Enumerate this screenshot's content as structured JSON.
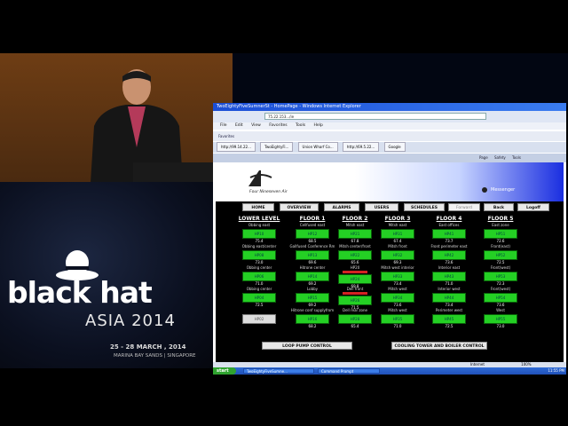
{
  "banner": {
    "title": "black hat",
    "subtitle": "ASIA 2014",
    "dates": "25 - 28 MARCH , 2014",
    "venue": "MARINA BAY SANDS  |  SINGAPORE"
  },
  "browser": {
    "window_title": "TwoEightyFiveSumnerSt - HomePage - Windows Internet Explorer",
    "address": "75.22.153.../ie",
    "menu": [
      "File",
      "Edit",
      "View",
      "Favorites",
      "Tools",
      "Help"
    ],
    "favorites_bar": "Favorites",
    "tabs": [
      "http://99.14.22...",
      "TwoEightyFi...",
      "Union Wharf Co...",
      "http://69.5.22...",
      "Google"
    ],
    "cmd_items": [
      "Page",
      "Safety",
      "Tools"
    ],
    "status_text": "Internet",
    "zoom": "100%"
  },
  "app": {
    "brand": "Four Nineseven Air",
    "user_label": "Messenger",
    "nav": [
      "HOME",
      "OVERVIEW",
      "ALARMS",
      "USERS",
      "SCHEDULES",
      "Forward",
      "Back",
      "Logoff"
    ],
    "floors": [
      {
        "name": "LOWER LEVEL",
        "zones": [
          {
            "label": "Obbing east",
            "btn": "HP10",
            "temp": "75.4"
          },
          {
            "label": "Obbing east/center",
            "btn": "HP08",
            "temp": "73.0"
          },
          {
            "label": "Obbing center",
            "btn": "HP06",
            "temp": "71.0"
          },
          {
            "label": "Obbing center",
            "btn": "HP04",
            "temp": "72.5"
          },
          {
            "label": "",
            "btn": "HP02",
            "temp": "",
            "off": true
          }
        ]
      },
      {
        "name": "FLOOR 1",
        "zones": [
          {
            "label": "Cellfused east",
            "btn": "HP12",
            "temp": "68.5"
          },
          {
            "label": "Gallfused Conference Rm",
            "btn": "HP13",
            "temp": "69.6"
          },
          {
            "label": "Hitrone center",
            "btn": "HP14",
            "temp": "69.2"
          },
          {
            "label": "Lobby",
            "btn": "HP15",
            "temp": "69.2"
          },
          {
            "label": "Hitrone conf supplyfrom",
            "btn": "HP16",
            "temp": "68.2"
          }
        ]
      },
      {
        "name": "FLOOR 2",
        "zones": [
          {
            "label": "Mitsh east",
            "btn": "HP21",
            "temp": "67.8"
          },
          {
            "label": "Mitsh center/front",
            "btn": "HP22",
            "temp": "65.6"
          },
          {
            "label": "HP20",
            "btn": "HP24",
            "temp": "69.8",
            "red": true
          },
          {
            "label": "Dell front",
            "btn": "HP26",
            "temp": "71.5",
            "red": true
          },
          {
            "label": "Dell rear zone",
            "btn": "HP28",
            "temp": "65.4"
          }
        ]
      },
      {
        "name": "FLOOR 3",
        "zones": [
          {
            "label": "Mitsh east",
            "btn": "HP31",
            "temp": "67.4"
          },
          {
            "label": "Mitsh front",
            "btn": "HP32",
            "temp": "69.3"
          },
          {
            "label": "Mitsh west interior",
            "btn": "HP33",
            "temp": "73.4"
          },
          {
            "label": "Mitsh west",
            "btn": "HP34",
            "temp": "73.6"
          },
          {
            "label": "Mitsh west",
            "btn": "HP35",
            "temp": "71.0"
          }
        ]
      },
      {
        "name": "FLOOR 4",
        "zones": [
          {
            "label": "East offices",
            "btn": "HP41",
            "temp": "73.7"
          },
          {
            "label": "Front perimeter east",
            "btn": "HP42",
            "temp": "73.6"
          },
          {
            "label": "Interior east",
            "btn": "HP43",
            "temp": "71.0"
          },
          {
            "label": "Interior west",
            "btn": "HP44",
            "temp": "73.4"
          },
          {
            "label": "Perimeter west",
            "btn": "HP45",
            "temp": "72.5"
          }
        ]
      },
      {
        "name": "FLOOR 5",
        "zones": [
          {
            "label": "East zone",
            "btn": "HP51",
            "temp": "72.6"
          },
          {
            "label": "Front(east)",
            "btn": "HP52",
            "temp": "72.5"
          },
          {
            "label": "Front(west)",
            "btn": "HP53",
            "temp": "72.3"
          },
          {
            "label": "Front(west)",
            "btn": "HP54",
            "temp": "73.6"
          },
          {
            "label": "West",
            "btn": "HP55",
            "temp": "73.0"
          }
        ]
      }
    ],
    "loop_btn": "LOOP PUMP CONTROL",
    "cool_btn": "COOLING TOWER AND BOILER CONTROL"
  },
  "taskbar": {
    "start": "start",
    "tasks": [
      "TwoEightyFiveSumne...",
      "Command Prompt"
    ],
    "clock": "11:55 PM"
  },
  "colors": {
    "green": "#24d024",
    "red": "#d32222",
    "ie_blue": "#1b4ed6"
  }
}
